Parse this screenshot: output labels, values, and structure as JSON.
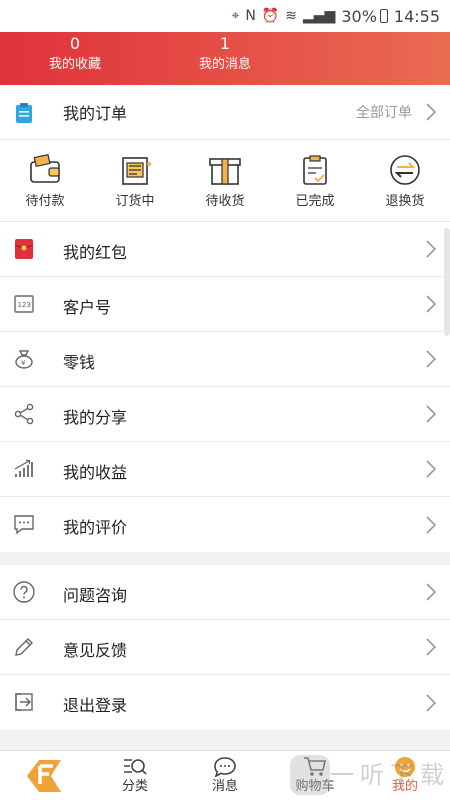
{
  "status_bar": {
    "battery": "30%",
    "time": "14:55"
  },
  "header": {
    "favorites": {
      "count": "0",
      "label": "我的收藏"
    },
    "messages": {
      "count": "1",
      "label": "我的消息"
    }
  },
  "orders": {
    "title": "我的订单",
    "all_label": "全部订单",
    "statuses": [
      {
        "label": "待付款",
        "icon": "wallet-icon"
      },
      {
        "label": "订货中",
        "icon": "building-icon"
      },
      {
        "label": "待收货",
        "icon": "package-icon"
      },
      {
        "label": "已完成",
        "icon": "checklist-icon"
      },
      {
        "label": "退换货",
        "icon": "exchange-icon"
      }
    ]
  },
  "menu_primary": [
    {
      "label": "我的红包",
      "icon": "red-envelope-icon"
    },
    {
      "label": "客户号",
      "icon": "id-card-icon"
    },
    {
      "label": "零钱",
      "icon": "money-bag-icon"
    },
    {
      "label": "我的分享",
      "icon": "share-icon"
    },
    {
      "label": "我的收益",
      "icon": "earnings-chart-icon"
    },
    {
      "label": "我的评价",
      "icon": "comment-icon"
    }
  ],
  "menu_secondary": [
    {
      "label": "问题咨询",
      "icon": "question-icon"
    },
    {
      "label": "意见反馈",
      "icon": "pencil-icon"
    },
    {
      "label": "退出登录",
      "icon": "logout-icon"
    }
  ],
  "tabbar": [
    {
      "label": "",
      "icon": "home-logo-icon"
    },
    {
      "label": "分类",
      "icon": "category-search-icon"
    },
    {
      "label": "消息",
      "icon": "message-bubble-icon"
    },
    {
      "label": "购物车",
      "icon": "cart-icon"
    },
    {
      "label": "我的",
      "icon": "profile-smile-icon",
      "active": true
    }
  ],
  "watermark": "一听下载",
  "colors": {
    "accent": "#e85d3a",
    "header_start": "#e0323a",
    "header_end": "#ea6b52"
  }
}
